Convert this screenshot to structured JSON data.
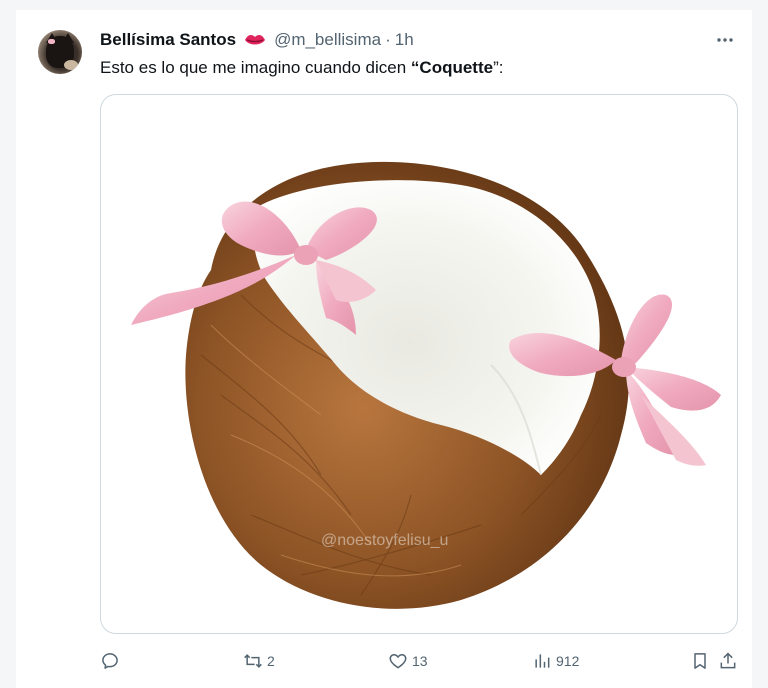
{
  "tweet": {
    "author_name": "Bellísima Santos",
    "handle": "@m_bellisima",
    "separator": "·",
    "time": "1h",
    "text_prefix": "Esto es lo que me imagino cuando dicen ",
    "text_quote_open": "“",
    "text_bold": "Coquette",
    "text_suffix": "”:",
    "watermark": "@noestoyfelisu_u"
  },
  "actions": {
    "replies": "",
    "retweets": "2",
    "likes": "13",
    "views": "912"
  },
  "icons": {
    "more": "more-horizontal-icon",
    "verified_emoji": "lips-emoji-icon",
    "reply": "reply-icon",
    "retweet": "retweet-icon",
    "like": "heart-icon",
    "views": "views-chart-icon",
    "bookmark": "bookmark-icon",
    "share": "share-icon"
  },
  "colors": {
    "text": "#0f1419",
    "secondary": "#536471",
    "border": "#cfd9de",
    "bow_pink": "#f2b6c6"
  }
}
